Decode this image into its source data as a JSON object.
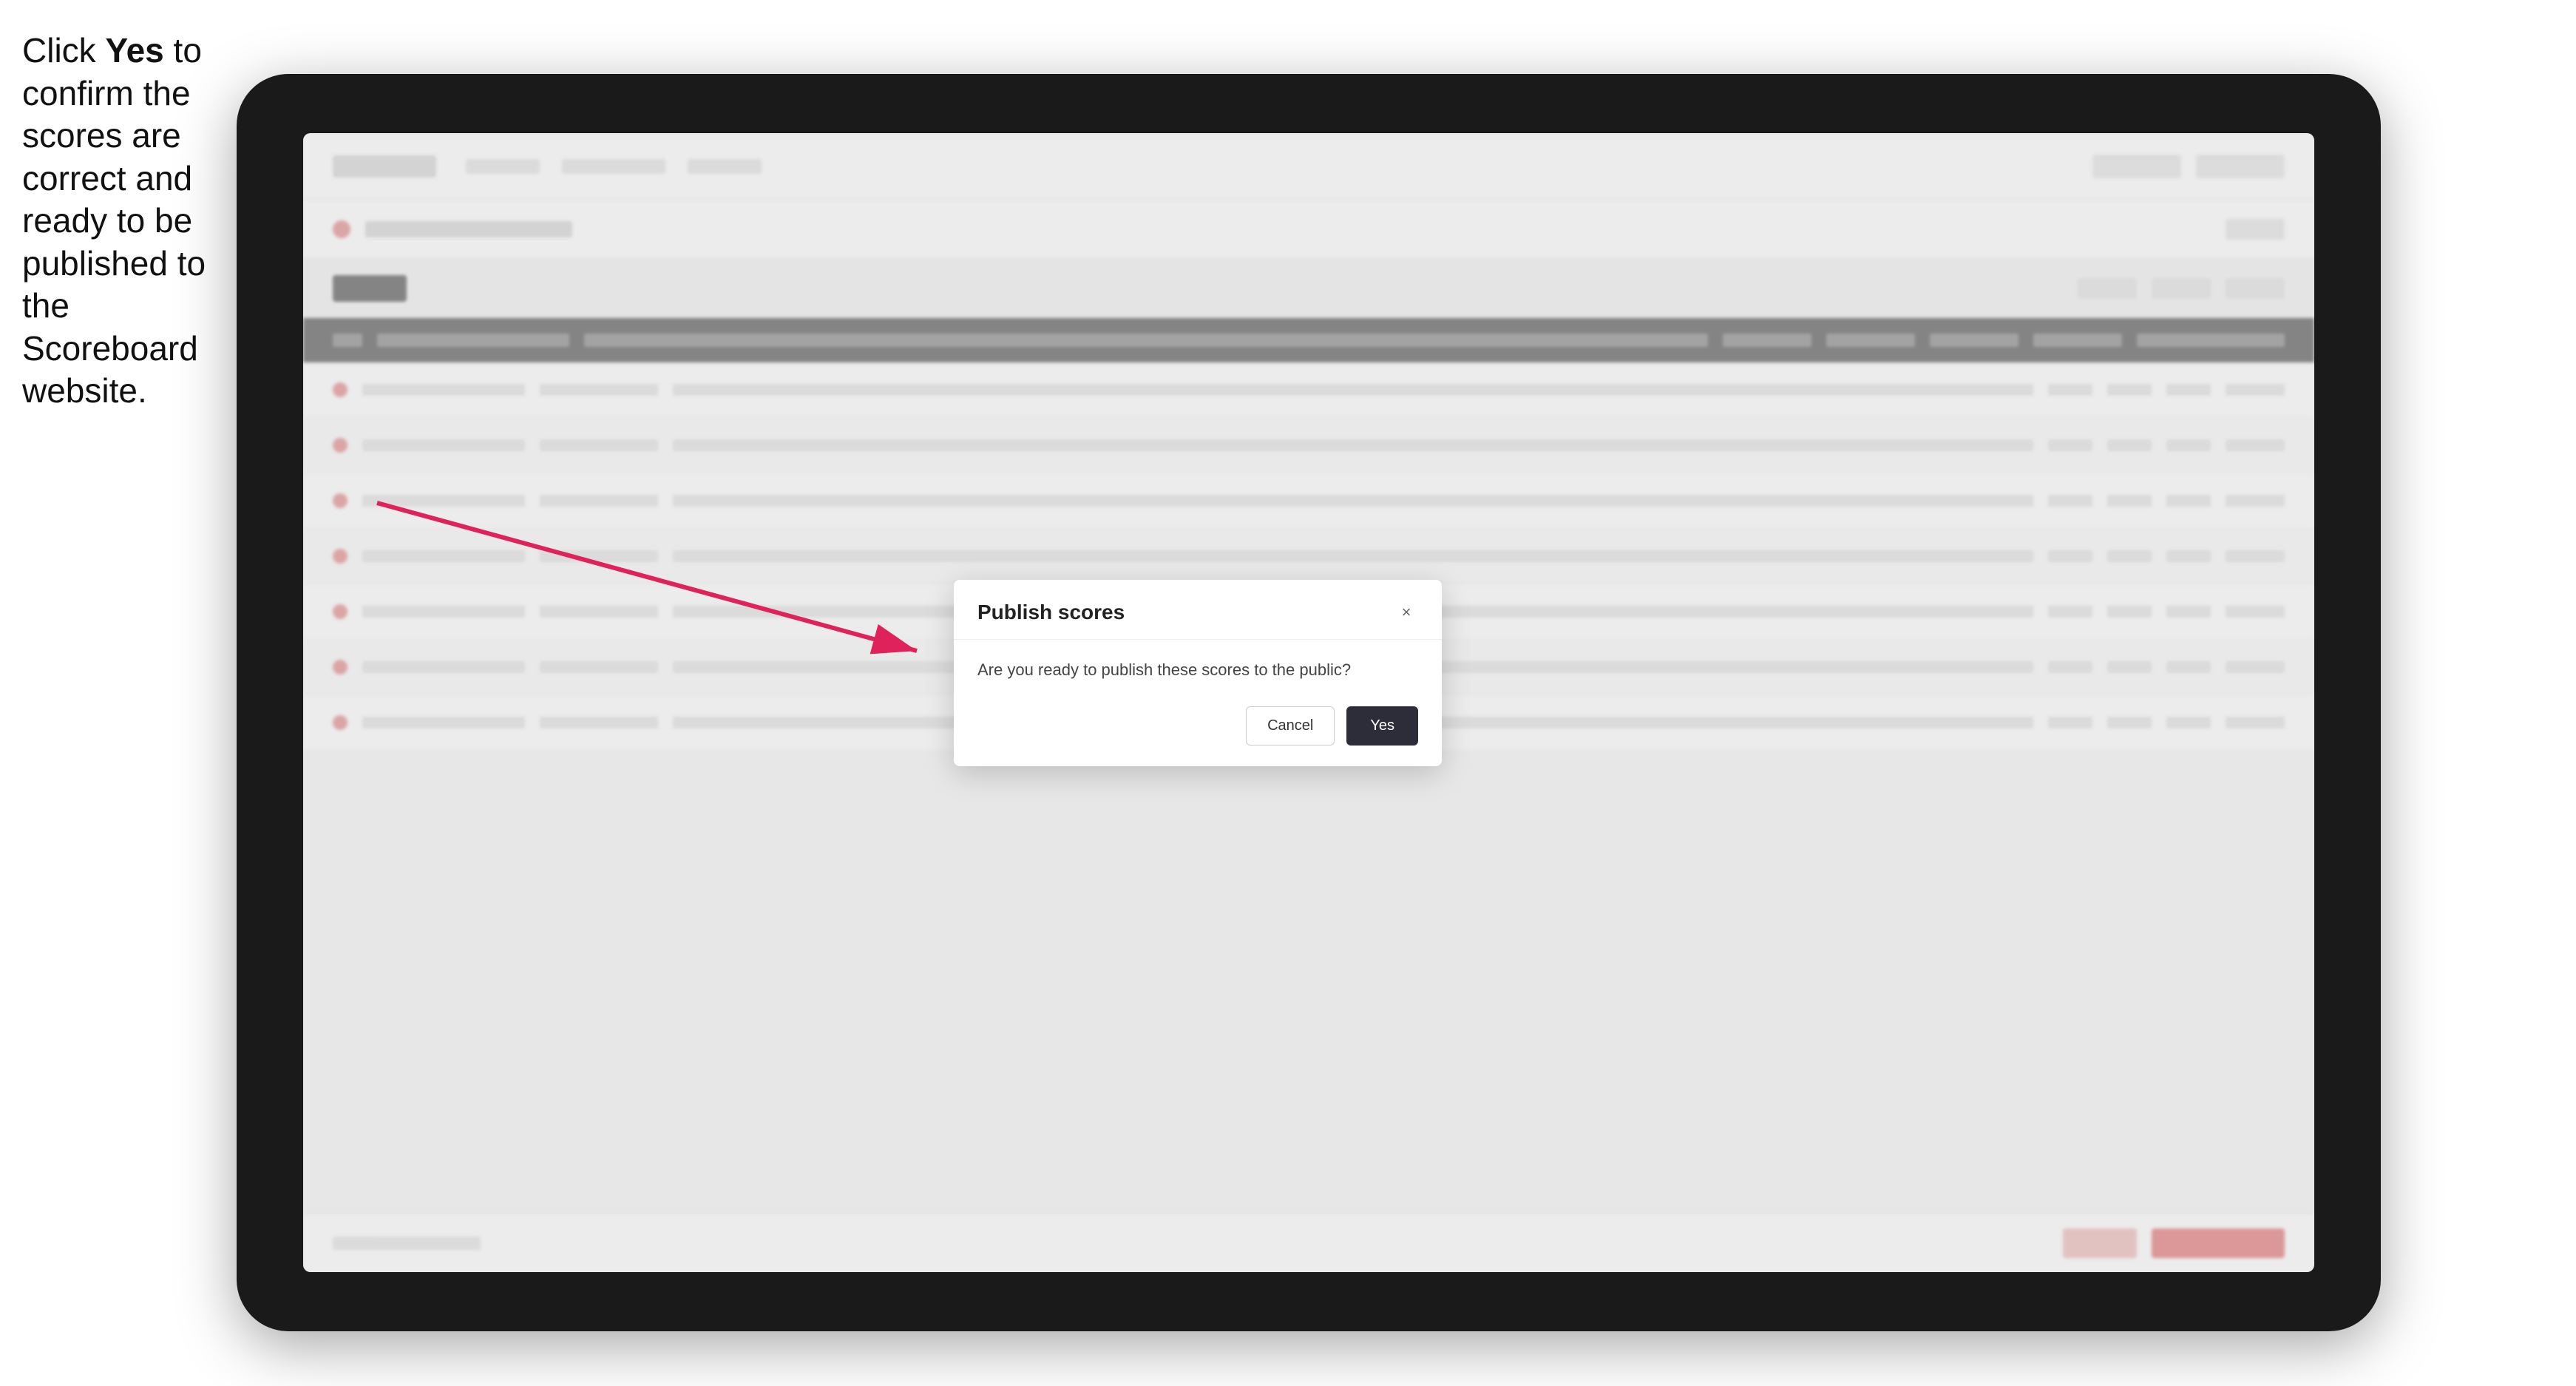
{
  "instruction": {
    "text_part1": "Click ",
    "text_bold": "Yes",
    "text_part2": " to confirm the scores are correct and ready to be published to the Scoreboard website."
  },
  "modal": {
    "title": "Publish scores",
    "message": "Are you ready to publish these scores to the public?",
    "cancel_label": "Cancel",
    "yes_label": "Yes",
    "close_icon": "×"
  },
  "colors": {
    "accent": "#e05555",
    "dark": "#2d2d3a"
  }
}
